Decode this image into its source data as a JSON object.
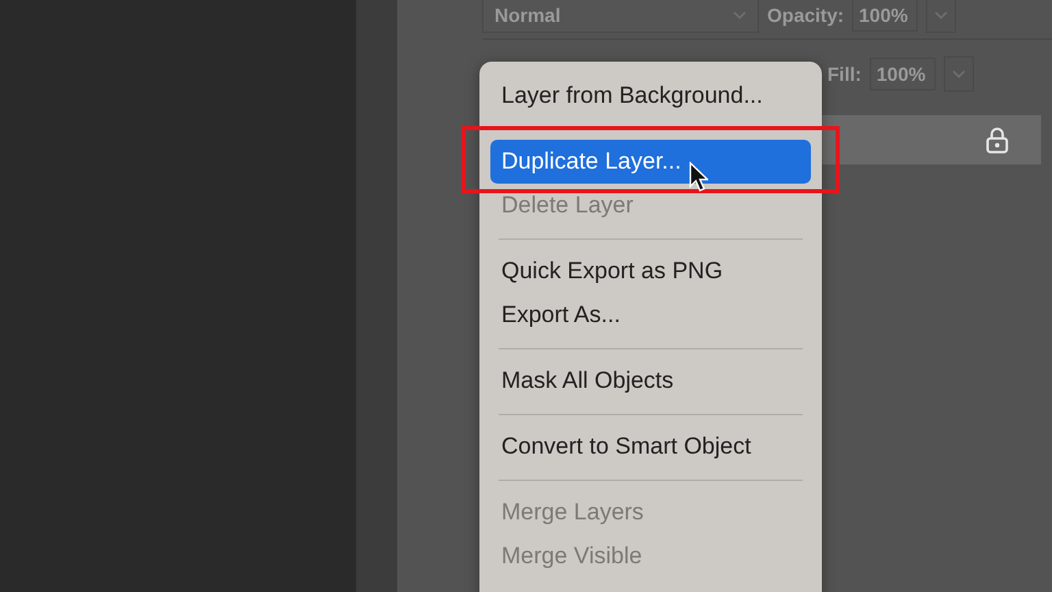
{
  "layers_panel": {
    "blend_mode": "Normal",
    "opacity_label": "Opacity:",
    "opacity": "100%",
    "fill_label": "Fill:",
    "fill": "100%"
  },
  "context_menu": [
    {
      "kind": "item",
      "label": "Layer from Background...",
      "disabled": false,
      "selected": false
    },
    {
      "kind": "separator"
    },
    {
      "kind": "item",
      "label": "Duplicate Layer...",
      "disabled": false,
      "selected": true
    },
    {
      "kind": "item",
      "label": "Delete Layer",
      "disabled": true,
      "selected": false
    },
    {
      "kind": "separator"
    },
    {
      "kind": "item",
      "label": "Quick Export as PNG",
      "disabled": false,
      "selected": false
    },
    {
      "kind": "item",
      "label": "Export As...",
      "disabled": false,
      "selected": false
    },
    {
      "kind": "separator"
    },
    {
      "kind": "item",
      "label": "Mask All Objects",
      "disabled": false,
      "selected": false
    },
    {
      "kind": "separator"
    },
    {
      "kind": "item",
      "label": "Convert to Smart Object",
      "disabled": false,
      "selected": false
    },
    {
      "kind": "separator"
    },
    {
      "kind": "item",
      "label": "Merge Layers",
      "disabled": true,
      "selected": false
    },
    {
      "kind": "item",
      "label": "Merge Visible",
      "disabled": true,
      "selected": false
    }
  ]
}
